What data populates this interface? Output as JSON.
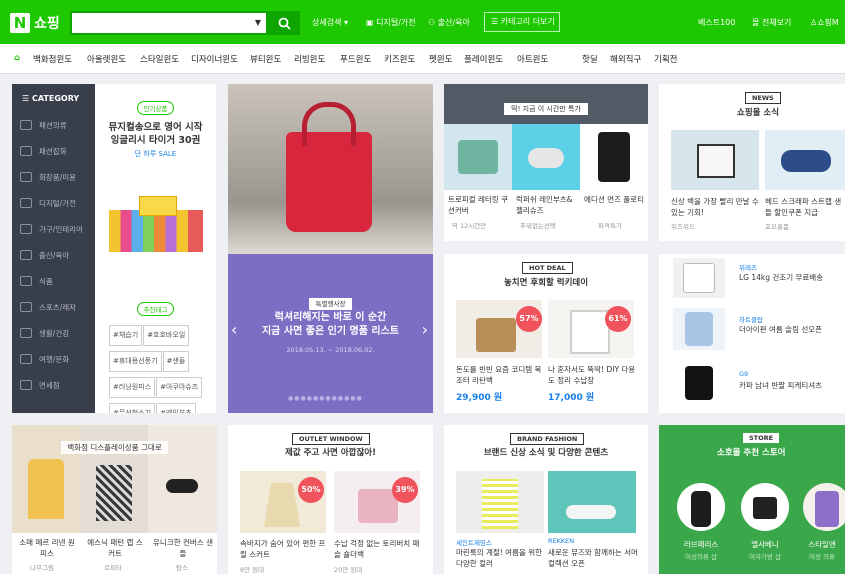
{
  "header": {
    "logo_letter": "N",
    "logo_text": "쇼핑",
    "detail_search": "상세검색 ▾",
    "digital": "디지털/가전",
    "baby": "출산/육아",
    "category_more": "카테고리 더보기",
    "best100": "베스트100",
    "view_all": "몰 전체보기",
    "my": "쇼핑M"
  },
  "nav": {
    "items": [
      "백화점윈도",
      "아울렛윈도",
      "스타일윈도",
      "디자이너윈도",
      "뷰티윈도",
      "리빙윈도",
      "푸드윈도",
      "키즈윈도",
      "펫윈도",
      "플레이윈도",
      "아트윈도",
      "핫딜",
      "해외직구",
      "기획전"
    ]
  },
  "sidebar": {
    "title": "CATEGORY",
    "items": [
      "패션의류",
      "패션잡화",
      "화장품/미용",
      "디지털/가전",
      "가구/인테리어",
      "출산/육아",
      "식품",
      "스포츠/레저",
      "생활/건강",
      "여행/문화",
      "면세점"
    ]
  },
  "popular": {
    "badge": "인기상품",
    "title1": "뮤지컬송으로 영어 시작",
    "title2": "잉글리시 타이거 30권",
    "sub": "단 하루 SALE",
    "rec_badge": "추천태그",
    "tags": [
      "#채습기",
      "#호호바오일",
      "#휴대용선풍기",
      "#샌들",
      "#러닝원피스",
      "#아쿠아슈즈",
      "#무선청소기",
      "#레인부츠"
    ]
  },
  "special": {
    "badge": "특별행사장",
    "line1": "럭셔리해지는 바로 이 순간",
    "line2": "지금 사면 좋은 인기 명품 리스트",
    "date": "2018.05.13. ~ 2018.06.02."
  },
  "timedeal": {
    "title": "딱! 지금 이 시간만 특가",
    "items": [
      {
        "name": "트로피컬 레터링 쿠션커버",
        "meta": "딱 12시간만"
      },
      {
        "name": "럭퍼쉬 레인부츠&젤리슈즈",
        "meta": "추워없는선택"
      },
      {
        "name": "에디션 면즈 폴로티",
        "meta": "파격특가"
      }
    ]
  },
  "hotdeal": {
    "badge": "HOT DEAL",
    "title": "놓치면 후회할 럭키데이",
    "items": [
      {
        "name": "돈도를 빈빈 요즘 코디템 북조터 라탄백",
        "price": "29,900 원",
        "sale": "57%"
      },
      {
        "name": "나 혼자서도 뚝딱! DIY 다용도 정리 수납장",
        "price": "17,000 원",
        "sale": "61%"
      }
    ]
  },
  "news": {
    "badge": "NEWS",
    "title": "쇼핑몰 소식",
    "items": [
      {
        "name": "신상 백을 가장 빨리 만날 수 있는 기회!",
        "meta": "위즈위드"
      },
      {
        "name": "헤드 스크래파 스트랩 샌들 할인쿠폰 지급",
        "meta": "포모롱폼"
      }
    ],
    "list": [
      {
        "brand": "위레즈",
        "text": "LG 14kg 건조기 무료배송"
      },
      {
        "brand": "하트클랍",
        "text": "더아이판 여름 슬림 선오픈"
      },
      {
        "brand": "G9",
        "text": "카파 남녀 반팔 피케티셔츠"
      }
    ]
  },
  "display": {
    "title": "백화점 디스플레이상품 그대로",
    "items": [
      {
        "name": "소매 페르 리넨 원피스",
        "meta": "나무그림"
      },
      {
        "name": "에스닉 패턴 랩 스커트",
        "meta": "르피타"
      },
      {
        "name": "유니크한 컨버스 샌들",
        "meta": "탐스"
      }
    ]
  },
  "outlet": {
    "badge": "OUTLET WINDOW",
    "title": "제값 주고 사면 아깝잖아!",
    "items": [
      {
        "name": "속바지가 숨어 있어 편한 프릴 스커트",
        "meta": "8만 원대",
        "sale": "50%"
      },
      {
        "name": "수납 걱정 없는 토리버치 패슬 숄더백",
        "meta": "20만 원대",
        "sale": "39%"
      }
    ]
  },
  "brand": {
    "badge": "BRAND FASHION",
    "title": "브랜드 신상 소식 및 다양한 콘텐츠",
    "items": [
      {
        "brand": "세인트제임스",
        "name": "마린룩의 계절! 여름을 위한 다양한 컬러"
      },
      {
        "brand": "REKKEN",
        "name": "새로운 뮤즈와 함께하는 서머 컬렉션 오픈"
      }
    ]
  },
  "store": {
    "badge": "STORE",
    "title": "소호몰 추천 스토어",
    "items": [
      {
        "name": "러브패리스",
        "meta": "여성의류 샵"
      },
      {
        "name": "앨사베니",
        "meta": "여자가방 샵"
      },
      {
        "name": "스타일앤",
        "meta": "여성 의류"
      }
    ]
  },
  "colors": {
    "green": "#1ec800",
    "dark": "#383e4a",
    "purple": "#7b6fc4",
    "blue": "#1a7fe8",
    "red": "#f0535b"
  }
}
